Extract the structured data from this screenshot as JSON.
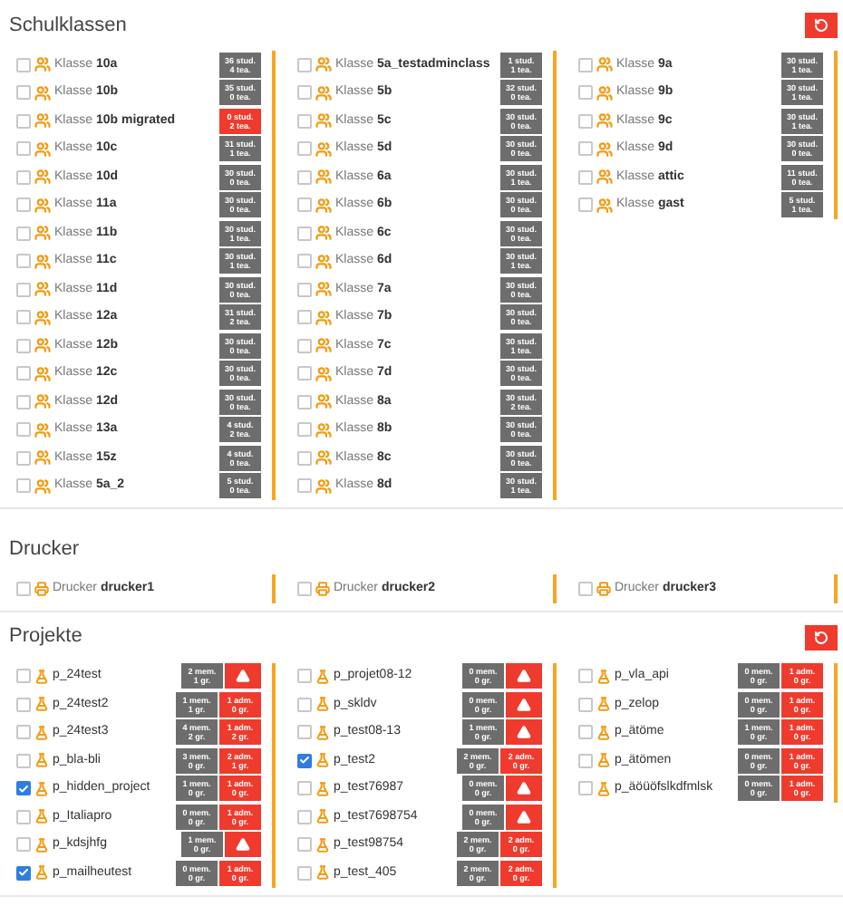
{
  "sections": [
    {
      "title": "Schulklassen",
      "reset_button": true,
      "kind": "classes",
      "columns": [
        [
          {
            "prefix": "Klasse",
            "name": "10a",
            "checked": false,
            "line1": "36 stud.",
            "line2": "4 tea.",
            "warn": false
          },
          {
            "prefix": "Klasse",
            "name": "10b",
            "checked": false,
            "line1": "35 stud.",
            "line2": "0 tea.",
            "warn": false
          },
          {
            "prefix": "Klasse",
            "name": "10b migrated",
            "checked": false,
            "line1": "0 stud.",
            "line2": "2 tea.",
            "warn": true
          },
          {
            "prefix": "Klasse",
            "name": "10c",
            "checked": false,
            "line1": "31 stud.",
            "line2": "1 tea.",
            "warn": false
          },
          {
            "prefix": "Klasse",
            "name": "10d",
            "checked": false,
            "line1": "30 stud.",
            "line2": "0 tea.",
            "warn": false
          },
          {
            "prefix": "Klasse",
            "name": "11a",
            "checked": false,
            "line1": "30 stud.",
            "line2": "0 tea.",
            "warn": false
          },
          {
            "prefix": "Klasse",
            "name": "11b",
            "checked": false,
            "line1": "30 stud.",
            "line2": "1 tea.",
            "warn": false
          },
          {
            "prefix": "Klasse",
            "name": "11c",
            "checked": false,
            "line1": "30 stud.",
            "line2": "1 tea.",
            "warn": false
          },
          {
            "prefix": "Klasse",
            "name": "11d",
            "checked": false,
            "line1": "30 stud.",
            "line2": "0 tea.",
            "warn": false
          },
          {
            "prefix": "Klasse",
            "name": "12a",
            "checked": false,
            "line1": "31 stud.",
            "line2": "2 tea.",
            "warn": false
          },
          {
            "prefix": "Klasse",
            "name": "12b",
            "checked": false,
            "line1": "30 stud.",
            "line2": "0 tea.",
            "warn": false
          },
          {
            "prefix": "Klasse",
            "name": "12c",
            "checked": false,
            "line1": "30 stud.",
            "line2": "0 tea.",
            "warn": false
          },
          {
            "prefix": "Klasse",
            "name": "12d",
            "checked": false,
            "line1": "30 stud.",
            "line2": "0 tea.",
            "warn": false
          },
          {
            "prefix": "Klasse",
            "name": "13a",
            "checked": false,
            "line1": "4 stud.",
            "line2": "2 tea.",
            "warn": false
          },
          {
            "prefix": "Klasse",
            "name": "15z",
            "checked": false,
            "line1": "4 stud.",
            "line2": "0 tea.",
            "warn": false
          },
          {
            "prefix": "Klasse",
            "name": "5a_2",
            "checked": false,
            "line1": "5 stud.",
            "line2": "0 tea.",
            "warn": false
          }
        ],
        [
          {
            "prefix": "Klasse",
            "name": "5a_testadminclass",
            "checked": false,
            "line1": "1 stud.",
            "line2": "1 tea.",
            "warn": false
          },
          {
            "prefix": "Klasse",
            "name": "5b",
            "checked": false,
            "line1": "32 stud.",
            "line2": "0 tea.",
            "warn": false
          },
          {
            "prefix": "Klasse",
            "name": "5c",
            "checked": false,
            "line1": "30 stud.",
            "line2": "0 tea.",
            "warn": false
          },
          {
            "prefix": "Klasse",
            "name": "5d",
            "checked": false,
            "line1": "30 stud.",
            "line2": "0 tea.",
            "warn": false
          },
          {
            "prefix": "Klasse",
            "name": "6a",
            "checked": false,
            "line1": "30 stud.",
            "line2": "1 tea.",
            "warn": false
          },
          {
            "prefix": "Klasse",
            "name": "6b",
            "checked": false,
            "line1": "30 stud.",
            "line2": "0 tea.",
            "warn": false
          },
          {
            "prefix": "Klasse",
            "name": "6c",
            "checked": false,
            "line1": "30 stud.",
            "line2": "0 tea.",
            "warn": false
          },
          {
            "prefix": "Klasse",
            "name": "6d",
            "checked": false,
            "line1": "30 stud.",
            "line2": "1 tea.",
            "warn": false
          },
          {
            "prefix": "Klasse",
            "name": "7a",
            "checked": false,
            "line1": "30 stud.",
            "line2": "0 tea.",
            "warn": false
          },
          {
            "prefix": "Klasse",
            "name": "7b",
            "checked": false,
            "line1": "30 stud.",
            "line2": "0 tea.",
            "warn": false
          },
          {
            "prefix": "Klasse",
            "name": "7c",
            "checked": false,
            "line1": "30 stud.",
            "line2": "1 tea.",
            "warn": false
          },
          {
            "prefix": "Klasse",
            "name": "7d",
            "checked": false,
            "line1": "30 stud.",
            "line2": "0 tea.",
            "warn": false
          },
          {
            "prefix": "Klasse",
            "name": "8a",
            "checked": false,
            "line1": "30 stud.",
            "line2": "2 tea.",
            "warn": false
          },
          {
            "prefix": "Klasse",
            "name": "8b",
            "checked": false,
            "line1": "30 stud.",
            "line2": "0 tea.",
            "warn": false
          },
          {
            "prefix": "Klasse",
            "name": "8c",
            "checked": false,
            "line1": "30 stud.",
            "line2": "0 tea.",
            "warn": false
          },
          {
            "prefix": "Klasse",
            "name": "8d",
            "checked": false,
            "line1": "30 stud.",
            "line2": "1 tea.",
            "warn": false
          }
        ],
        [
          {
            "prefix": "Klasse",
            "name": "9a",
            "checked": false,
            "line1": "30 stud.",
            "line2": "1 tea.",
            "warn": false
          },
          {
            "prefix": "Klasse",
            "name": "9b",
            "checked": false,
            "line1": "30 stud.",
            "line2": "1 tea.",
            "warn": false
          },
          {
            "prefix": "Klasse",
            "name": "9c",
            "checked": false,
            "line1": "30 stud.",
            "line2": "1 tea.",
            "warn": false
          },
          {
            "prefix": "Klasse",
            "name": "9d",
            "checked": false,
            "line1": "30 stud.",
            "line2": "0 tea.",
            "warn": false
          },
          {
            "prefix": "Klasse",
            "name": "attic",
            "checked": false,
            "line1": "11 stud.",
            "line2": "0 tea.",
            "warn": false
          },
          {
            "prefix": "Klasse",
            "name": "gast",
            "checked": false,
            "line1": "5 stud.",
            "line2": "1 tea.",
            "warn": false
          }
        ]
      ]
    },
    {
      "title": "Drucker",
      "reset_button": false,
      "kind": "printers",
      "columns": [
        [
          {
            "prefix": "Drucker",
            "name": "drucker1",
            "checked": false
          }
        ],
        [
          {
            "prefix": "Drucker",
            "name": "drucker2",
            "checked": false
          }
        ],
        [
          {
            "prefix": "Drucker",
            "name": "drucker3",
            "checked": false
          }
        ]
      ]
    },
    {
      "title": "Projekte",
      "reset_button": true,
      "kind": "projects",
      "columns": [
        [
          {
            "name": "p_24test",
            "checked": false,
            "members": [
              "2 mem.",
              "1 gr."
            ]
          },
          {
            "name": "p_24test2",
            "checked": false,
            "members": [
              "1 mem.",
              "1 gr."
            ],
            "admins": [
              "1 adm.",
              "0 gr."
            ]
          },
          {
            "name": "p_24test3",
            "checked": false,
            "members": [
              "4 mem.",
              "2 gr."
            ],
            "admins": [
              "1 adm.",
              "2 gr."
            ]
          },
          {
            "name": "p_bla-bli",
            "checked": false,
            "members": [
              "3 mem.",
              "0 gr."
            ],
            "admins": [
              "2 adm.",
              "1 gr."
            ]
          },
          {
            "name": "p_hidden_project",
            "checked": true,
            "members": [
              "1 mem.",
              "0 gr."
            ],
            "admins": [
              "1 adm.",
              "0 gr."
            ]
          },
          {
            "name": "p_Italiapro",
            "checked": false,
            "members": [
              "0 mem.",
              "0 gr."
            ],
            "admins": [
              "1 adm.",
              "0 gr."
            ]
          },
          {
            "name": "p_kdsjhfg",
            "checked": false,
            "members": [
              "1 mem.",
              "0 gr."
            ]
          },
          {
            "name": "p_mailheutest",
            "checked": true,
            "members": [
              "0 mem.",
              "0 gr."
            ],
            "admins": [
              "1 adm.",
              "0 gr."
            ]
          }
        ],
        [
          {
            "name": "p_projet08-12",
            "checked": false,
            "members": [
              "0 mem.",
              "0 gr."
            ]
          },
          {
            "name": "p_skldv",
            "checked": false,
            "members": [
              "0 mem.",
              "0 gr."
            ]
          },
          {
            "name": "p_test08-13",
            "checked": false,
            "members": [
              "1 mem.",
              "0 gr."
            ]
          },
          {
            "name": "p_test2",
            "checked": true,
            "members": [
              "2 mem.",
              "0 gr."
            ],
            "admins": [
              "2 adm.",
              "0 gr."
            ]
          },
          {
            "name": "p_test76987",
            "checked": false,
            "members": [
              "0 mem.",
              "0 gr."
            ]
          },
          {
            "name": "p_test7698754",
            "checked": false,
            "members": [
              "0 mem.",
              "0 gr."
            ]
          },
          {
            "name": "p_test98754",
            "checked": false,
            "members": [
              "2 mem.",
              "0 gr."
            ],
            "admins": [
              "2 adm.",
              "0 gr."
            ]
          },
          {
            "name": "p_test_405",
            "checked": false,
            "members": [
              "2 mem.",
              "0 gr."
            ],
            "admins": [
              "2 adm.",
              "0 gr."
            ]
          }
        ],
        [
          {
            "name": "p_vla_api",
            "checked": false,
            "members": [
              "0 mem.",
              "0 gr."
            ],
            "admins": [
              "1 adm.",
              "0 gr."
            ]
          },
          {
            "name": "p_zelop",
            "checked": false,
            "members": [
              "0 mem.",
              "0 gr."
            ],
            "admins": [
              "1 adm.",
              "0 gr."
            ]
          },
          {
            "name": "p_ätöme",
            "checked": false,
            "members": [
              "1 mem.",
              "0 gr."
            ],
            "admins": [
              "1 adm.",
              "0 gr."
            ]
          },
          {
            "name": "p_ätömen",
            "checked": false,
            "members": [
              "0 mem.",
              "0 gr."
            ],
            "admins": [
              "1 adm.",
              "0 gr."
            ]
          },
          {
            "name": "p_äöüöfslkdfmlsk",
            "checked": false,
            "members": [
              "0 mem.",
              "0 gr."
            ],
            "admins": [
              "1 adm.",
              "0 gr."
            ]
          }
        ]
      ]
    }
  ]
}
